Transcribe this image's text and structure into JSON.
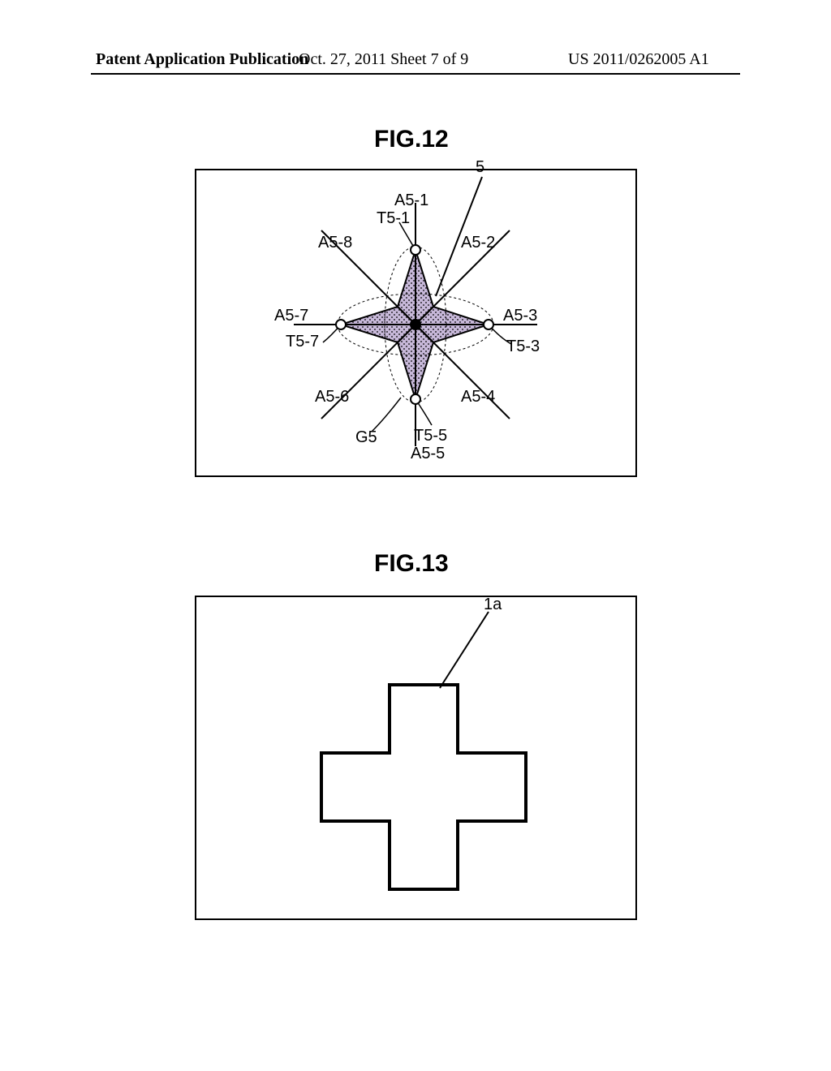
{
  "header": {
    "left": "Patent Application Publication",
    "center": "Oct. 27, 2011  Sheet 7 of 9",
    "right": "US 2011/0262005 A1"
  },
  "figures": {
    "fig12": {
      "title": "FIG.12"
    },
    "fig13": {
      "title": "FIG.13"
    }
  },
  "labels12": {
    "ref5": "5",
    "a5_1": "A5-1",
    "t5_1": "T5-1",
    "a5_2": "A5-2",
    "a5_3": "A5-3",
    "t5_3": "T5-3",
    "a5_4": "A5-4",
    "a5_5": "A5-5",
    "t5_5": "T5-5",
    "g5": "G5",
    "a5_6": "A5-6",
    "a5_7": "A5-7",
    "t5_7": "T5-7",
    "a5_8": "A5-8"
  },
  "labels13": {
    "ref1a": "1a"
  }
}
